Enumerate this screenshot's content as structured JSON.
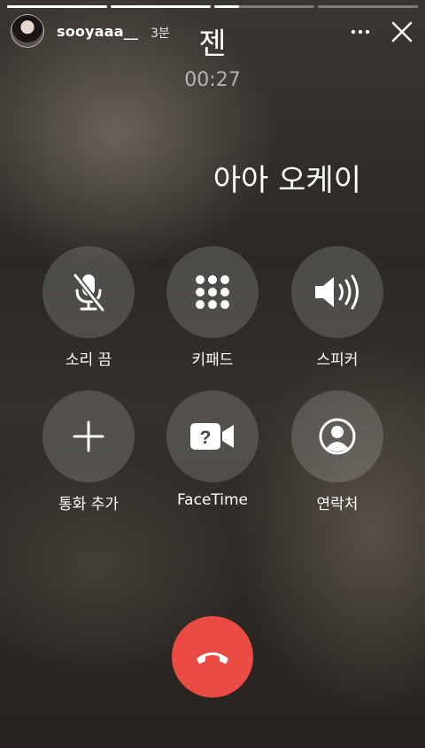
{
  "story": {
    "username": "sooyaaa__",
    "time_ago": "3분",
    "progress": [
      1.0,
      1.0,
      0.25,
      0.0
    ]
  },
  "call": {
    "name": "젠",
    "duration": "00:27"
  },
  "caption": "아아 오케이",
  "buttons": {
    "mute_label": "소리 끔",
    "keypad_label": "키패드",
    "speaker_label": "스피커",
    "add_call_label": "통화 추가",
    "facetime_label": "FaceTime",
    "contacts_label": "연락처"
  },
  "icons": {
    "more": "more-icon",
    "close": "close-icon",
    "mute": "mic-off-icon",
    "keypad": "keypad-grid-icon",
    "speaker": "speaker-icon",
    "add_call": "plus-icon",
    "facetime": "video-camera-icon",
    "contacts": "person-circle-icon",
    "end_call": "end-call-phone-icon"
  },
  "colors": {
    "end_call": "#ec4b43",
    "button_bg": "rgba(255,255,255,0.16)"
  }
}
